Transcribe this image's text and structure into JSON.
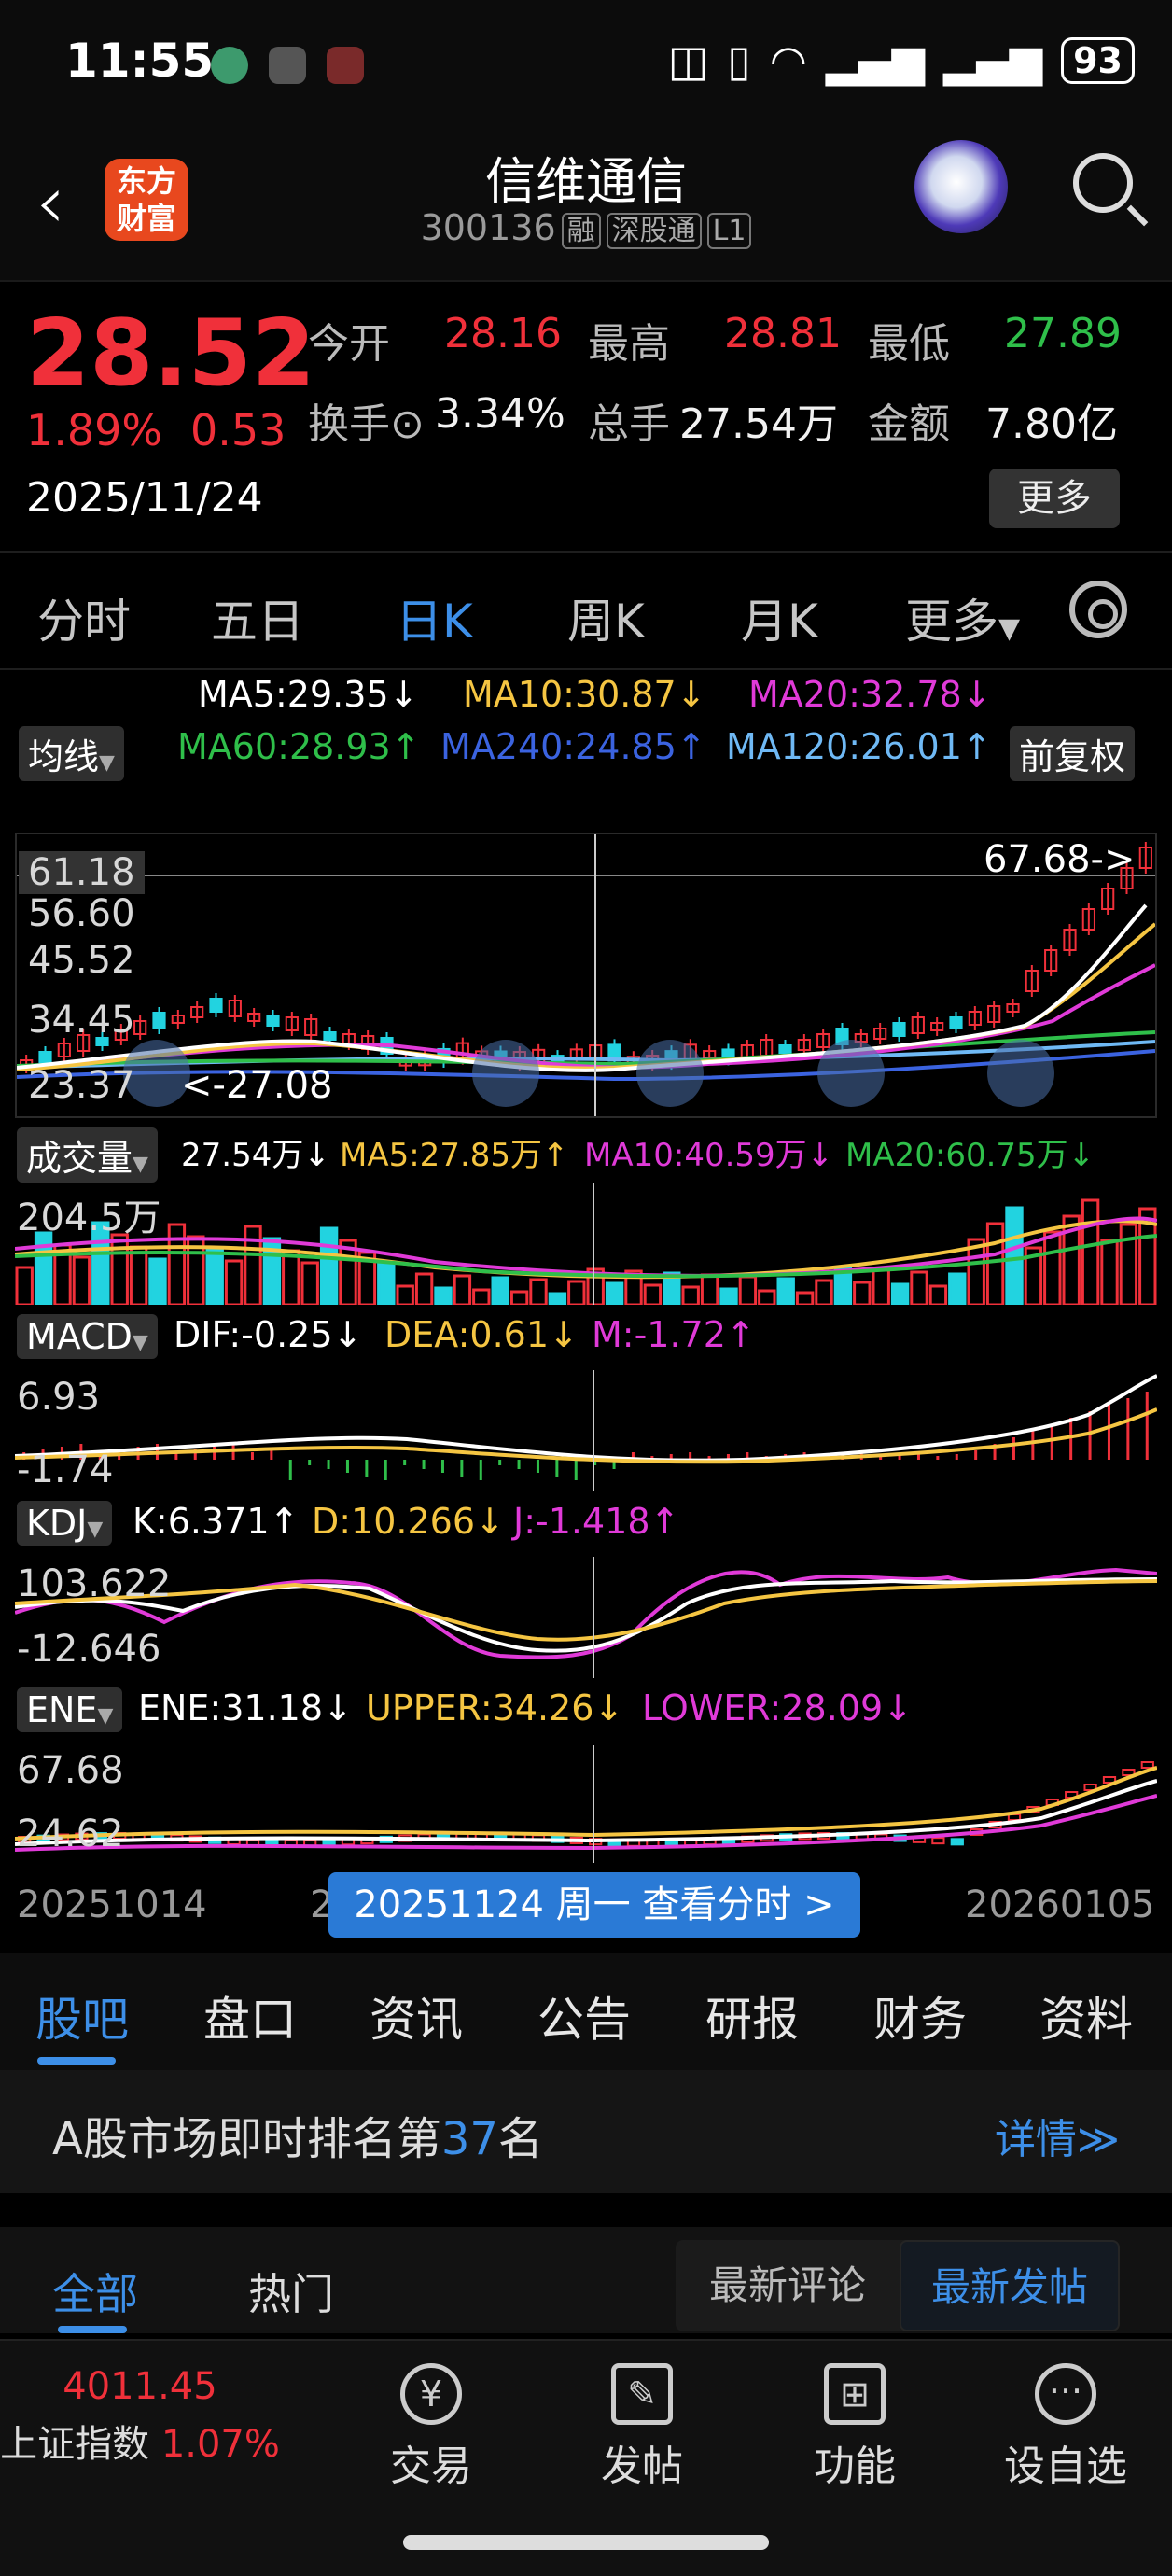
{
  "status_bar": {
    "time": "11:55",
    "battery": "93"
  },
  "header": {
    "logo_text": "东方财富",
    "title": "信维通信",
    "code": "300136",
    "tags": [
      "融",
      "深股通",
      "L1"
    ]
  },
  "quote": {
    "price": "28.52",
    "change_pct": "1.89%",
    "change": "0.53",
    "date": "2025/11/24",
    "open_label": "今开",
    "open": "28.16",
    "high_label": "最高",
    "high": "28.81",
    "low_label": "最低",
    "low": "27.89",
    "turnover_label": "换手",
    "turnover": "3.34%",
    "volume_label": "总手",
    "volume": "27.54万",
    "amount_label": "金额",
    "amount": "7.80亿",
    "more": "更多"
  },
  "periods": [
    "分时",
    "五日",
    "日K",
    "周K",
    "月K",
    "更多"
  ],
  "active_period": "日K",
  "ma_legend": {
    "chip": "均线",
    "ma5": "MA5:29.35↓",
    "ma10": "MA10:30.87↓",
    "ma20": "MA20:32.78↓",
    "ma60": "MA60:28.93↑",
    "ma240": "MA240:24.85↑",
    "ma120": "MA120:26.01↑",
    "adjust": "前复权"
  },
  "colors": {
    "up": "#f0303a",
    "down": "#22d3e0",
    "ma5": "#ffffff",
    "ma10": "#f5c542",
    "ma20": "#e03ad8",
    "ma60": "#2fbf4a",
    "ma240": "#3b63e0",
    "ma120": "#6fb9f5",
    "accent": "#3d8fe8"
  },
  "kline": {
    "axis_labels": [
      "61.18",
      "56.60",
      "45.52",
      "34.45",
      "23.37"
    ],
    "max_note": "67.68->",
    "min_note": "<-27.08"
  },
  "volume": {
    "chip": "成交量",
    "vol": "27.54万↓",
    "ma5": "MA5:27.85万↑",
    "ma10": "MA10:40.59万↓",
    "ma20": "MA20:60.75万↓",
    "axis": "204.5万"
  },
  "macd": {
    "chip": "MACD",
    "dif": "DIF:-0.25↓",
    "dea": "DEA:0.61↓",
    "m": "M:-1.72↑",
    "axis_top": "6.93",
    "axis_bottom": "-1.74"
  },
  "kdj": {
    "chip": "KDJ",
    "k": "K:6.371↑",
    "d": "D:10.266↓",
    "j": "J:-1.418↑",
    "axis_top": "103.622",
    "axis_bottom": "-12.646"
  },
  "ene": {
    "chip": "ENE",
    "ene": "ENE:31.18↓",
    "upper": "UPPER:34.26↓",
    "lower": "LOWER:28.09↓",
    "axis_top": "67.68",
    "axis_bottom": "24.62"
  },
  "x_axis": {
    "start": "20251014",
    "mid": "202",
    "end": "20260105"
  },
  "crosshair_badge": "20251124 周一 查看分时 >",
  "footer_tabs": [
    "股吧",
    "盘口",
    "资讯",
    "公告",
    "研报",
    "财务",
    "资料"
  ],
  "rank": {
    "prefix": "A股市场即时排名第",
    "num": "37",
    "suffix": "名",
    "detail": "详情≫"
  },
  "feed": {
    "tab_all": "全部",
    "tab_hot": "热门",
    "seg_left": "最新评论",
    "seg_right": "最新发帖"
  },
  "bottom_nav": {
    "index_value": "4011.45",
    "index_name": "上证指数",
    "index_pct": "1.07%",
    "trade": "交易",
    "post": "发帖",
    "func": "功能",
    "watch": "设自选"
  }
}
